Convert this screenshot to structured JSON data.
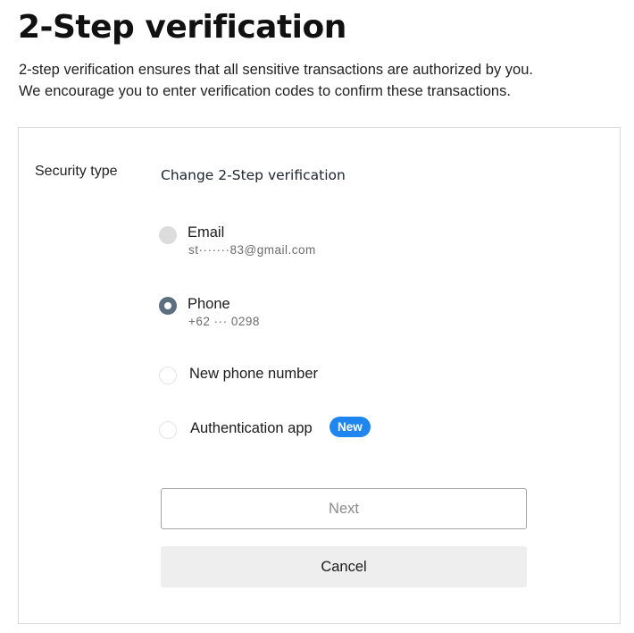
{
  "page": {
    "title": "2-Step verification",
    "intro_line1": "2-step verification ensures that all sensitive transactions are authorized by you.",
    "intro_line2": "We encourage you to enter verification codes to confirm these transactions."
  },
  "form": {
    "security_type_label": "Security type",
    "section_title": "Change 2-Step verification",
    "selected_option": "phone",
    "options": [
      {
        "id": "email",
        "label": "Email",
        "detail": "st·······83@gmail.com",
        "state": "disabled"
      },
      {
        "id": "phone",
        "label": "Phone",
        "detail": "+62 ··· 0298",
        "state": "checked"
      },
      {
        "id": "new_phone",
        "label": "New phone number",
        "state": "unchecked"
      },
      {
        "id": "auth_app",
        "label": "Authentication app",
        "badge": "New",
        "state": "unchecked"
      }
    ],
    "next_label": "Next",
    "cancel_label": "Cancel"
  },
  "colors": {
    "badge": "#1f86f0",
    "radio_checked": "#5b6f80",
    "radio_disabled": "#dcdcdc",
    "cancel_bg": "#eeeeee"
  }
}
